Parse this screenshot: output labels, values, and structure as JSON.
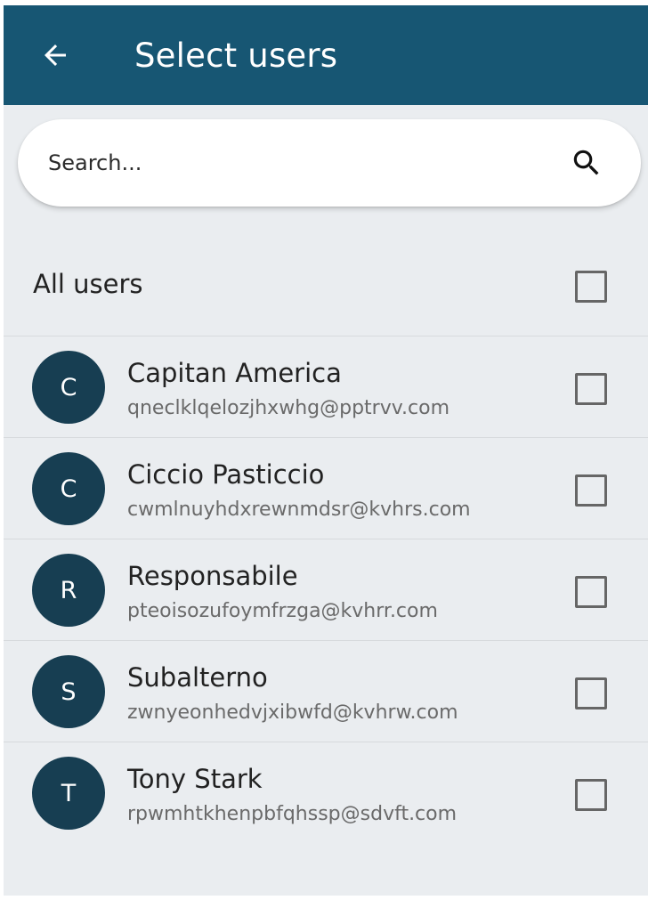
{
  "appbar": {
    "back_icon": "arrow-left-icon",
    "title": "Select users"
  },
  "search": {
    "placeholder": "Search...",
    "value": "",
    "icon": "search-icon"
  },
  "all_users": {
    "label": "All users",
    "checked": false
  },
  "users": [
    {
      "initial": "C",
      "name": "Capitan America",
      "email": "qneclklqelozjhxwhg@pptrvv.com",
      "checked": false
    },
    {
      "initial": "C",
      "name": "Ciccio Pasticcio",
      "email": "cwmlnuyhdxrewnmdsr@kvhrs.com",
      "checked": false
    },
    {
      "initial": "R",
      "name": "Responsabile",
      "email": "pteoisozufoymfrzga@kvhrr.com",
      "checked": false
    },
    {
      "initial": "S",
      "name": "Subalterno",
      "email": "zwnyeonhedvjxibwfd@kvhrw.com",
      "checked": false
    },
    {
      "initial": "T",
      "name": "Tony Stark",
      "email": "rpwmhtkhenpbfqhssp@sdvft.com",
      "checked": false
    }
  ],
  "colors": {
    "appbar": "#175673",
    "background": "#eaedf0",
    "avatar": "#173e52",
    "checkbox_border": "#666666"
  }
}
